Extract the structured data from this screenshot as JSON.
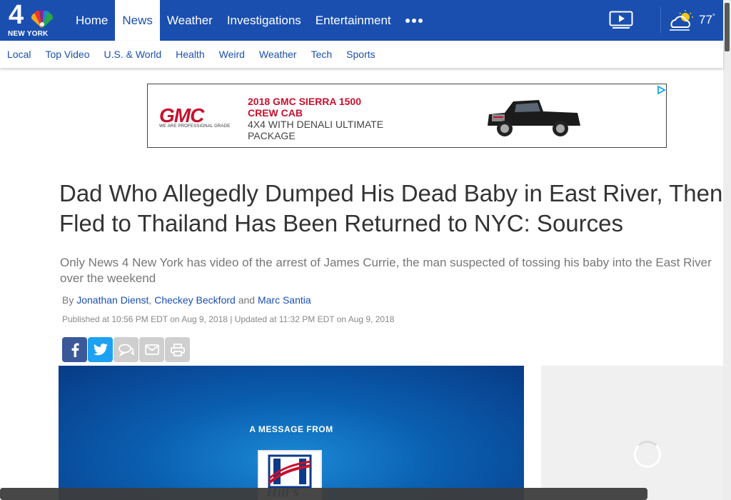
{
  "brand": {
    "logo_number": "4",
    "logo_text": "NEW YORK",
    "primary_color": "#1a4fb0"
  },
  "nav": {
    "items": [
      {
        "label": "Home",
        "active": false
      },
      {
        "label": "News",
        "active": true
      },
      {
        "label": "Weather",
        "active": false
      },
      {
        "label": "Investigations",
        "active": false
      },
      {
        "label": "Entertainment",
        "active": false
      }
    ],
    "more_icon": "more-dots-icon",
    "video_icon": "video-play-icon",
    "weather_icon": "partly-cloudy-icon",
    "temperature": "77",
    "temperature_unit": "°"
  },
  "subnav": {
    "items": [
      "Local",
      "Top Video",
      "U.S. & World",
      "Health",
      "Weird",
      "Weather",
      "Tech",
      "Sports"
    ]
  },
  "ad": {
    "brand": "GMC",
    "tagline": "WE ARE PROFESSIONAL GRADE",
    "title_line1": "2018 GMC SIERRA 1500",
    "title_line2": "CREW CAB",
    "subtitle": "4X4 WITH DENALI ULTIMATE PACKAGE",
    "adchoices_icon": "adchoices-icon",
    "brand_color": "#c8102e"
  },
  "article": {
    "headline_line1": "Dad Who Allegedly Dumped His Dead Baby in East River, Then",
    "headline_line2": "Fled to Thailand Has Been Returned to NYC: Sources",
    "dek_line1": "Only News 4 New York has video of the arrest of James Currie, the man suspected of tossing his baby into the East River",
    "dek_line2": "over the weekend",
    "byline_prefix": "By",
    "authors": [
      "Jonathan Dienst",
      "Checkey Beckford",
      "Marc Santia"
    ],
    "author_sep": ",",
    "author_and": "and",
    "dates": "Published at 10:56 PM EDT on Aug 9, 2018 | Updated at 11:32 PM EDT on Aug 9, 2018"
  },
  "share": {
    "buttons": [
      "facebook-icon",
      "twitter-icon",
      "comment-icon",
      "email-icon",
      "print-icon"
    ]
  },
  "video": {
    "message": "A MESSAGE FROM",
    "sponsor": "Hill's"
  }
}
